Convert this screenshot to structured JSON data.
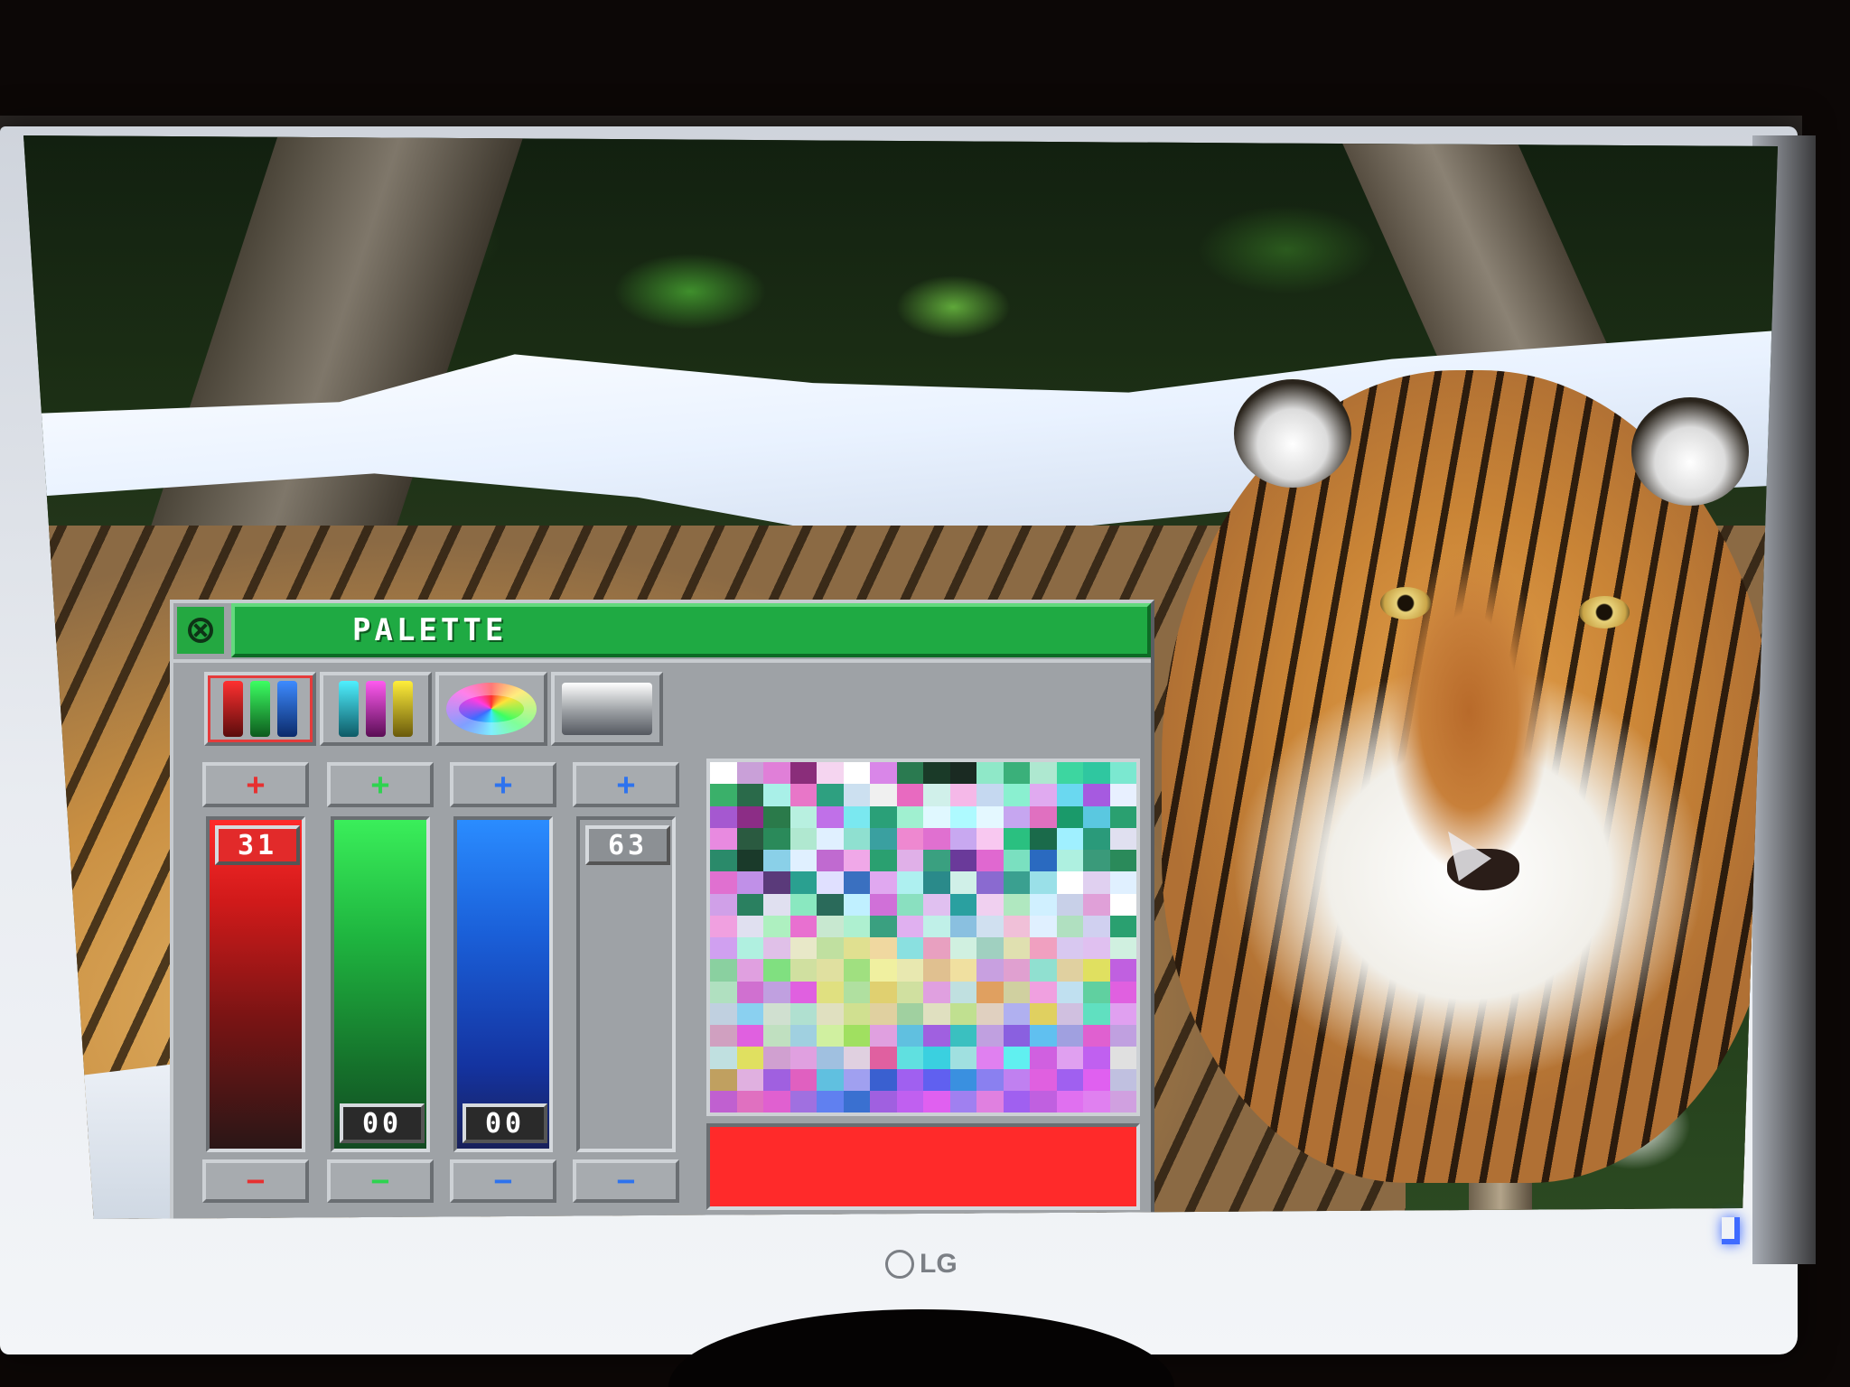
{
  "window": {
    "title": "PALETTE",
    "close_icon": "close-icon"
  },
  "mode_buttons": [
    {
      "name": "rgb-mode-icon",
      "active": true
    },
    {
      "name": "cmy-mode-icon",
      "active": false
    },
    {
      "name": "color-wheel-icon",
      "active": false
    },
    {
      "name": "greyscale-icon",
      "active": false
    }
  ],
  "sliders": {
    "red": {
      "plus": "+",
      "minus": "−",
      "value": "31",
      "color": "#e22a2a"
    },
    "green": {
      "plus": "+",
      "minus": "−",
      "value": "00",
      "color": "#2ed34f"
    },
    "blue": {
      "plus": "+",
      "minus": "−",
      "value": "00",
      "color": "#2e73ee"
    },
    "level": {
      "plus": "+",
      "minus": "−",
      "value": "63",
      "color": "#9ea2a6"
    }
  },
  "current_color": "#ff2a2a",
  "swatch_colors": [
    "#ffffff",
    "#c9a0d8",
    "#e07fd8",
    "#8a2d7a",
    "#f5d5f0",
    "#ffffff",
    "#d986e8",
    "#2a7a50",
    "#1a3a28",
    "#1a2a22",
    "#8fe8c8",
    "#3ab07a",
    "#aee8d0",
    "#3dd6a0",
    "#2fc7a0",
    "#7be8d0",
    "#3ab06a",
    "#2a6a4a",
    "#a9f0e8",
    "#e876c8",
    "#2ea080",
    "#cce0f0",
    "#f0f0f0",
    "#e86ac0",
    "#d0f0ea",
    "#f5b8e8",
    "#c5d8f0",
    "#8af0d0",
    "#e0aaf0",
    "#6ad8f0",
    "#a65ae0",
    "#e8f0ff",
    "#a558d0",
    "#8c2d86",
    "#2a7a4a",
    "#b8f0e0",
    "#c070e8",
    "#7ae8f0",
    "#2aa078",
    "#a0f0d0",
    "#e0f8ff",
    "#aefaff",
    "#e4f8ff",
    "#c6a6f0",
    "#e070c0",
    "#1a9a6a",
    "#5ac8e0",
    "#2aa070",
    "#e88ae0",
    "#2a5a40",
    "#2a8a5a",
    "#b0e8d0",
    "#e0f0ff",
    "#8fe0d0",
    "#3aa0a0",
    "#ee88d0",
    "#e070d0",
    "#c8a8f0",
    "#f8c8f0",
    "#2ac080",
    "#1a6a4a",
    "#a0f0ff",
    "#2a9a7a",
    "#e0e0f0",
    "#2a8a6a",
    "#1a3a2a",
    "#8ad0e8",
    "#e0f0ff",
    "#c06ad0",
    "#f0a8e8",
    "#2aa070",
    "#e0b0e8",
    "#3aa080",
    "#6a3a9a",
    "#e068d0",
    "#7ae0c0",
    "#2a6ac0",
    "#aef0e0",
    "#3a9a7a",
    "#2a8a5a",
    "#e070d0",
    "#c090e8",
    "#5a3a7a",
    "#2aa090",
    "#e0e0ff",
    "#3a70c0",
    "#e0a8f0",
    "#aef0f0",
    "#2a8a8a",
    "#d0f0e8",
    "#8a6ad0",
    "#3aa090",
    "#9ae0e8",
    "#ffffff",
    "#e0d0f0",
    "#e0f0ff",
    "#d0a0e8",
    "#2a8060",
    "#e0e0f0",
    "#8ae8c0",
    "#2a6a5a",
    "#c0f0ff",
    "#d070d8",
    "#8ae0c0",
    "#e0c0f0",
    "#2aa0a0",
    "#f0d0f0",
    "#b0e8c0",
    "#d0f0ff",
    "#c8d0e8",
    "#e0a0d8",
    "#ffffff",
    "#f0a0e0",
    "#e0e0f0",
    "#aef0c0",
    "#e870d0",
    "#c8e8d0",
    "#aef0d0",
    "#3aa080",
    "#e0b0f0",
    "#c0f0e8",
    "#8ac0e0",
    "#d0e0f0",
    "#f0c0d8",
    "#e0f0ff",
    "#b0e0c0",
    "#d0d0f0",
    "#2aa070",
    "#d0a0f0",
    "#b0f0e0",
    "#e0c0e8",
    "#e8e8c8",
    "#c0e0a0",
    "#e0e090",
    "#f0d8a0",
    "#8ae0e0",
    "#e8a0c0",
    "#d0f0e0",
    "#a0d0c0",
    "#e0e0b0",
    "#f0a0c0",
    "#d8c8f0",
    "#e0c0f0",
    "#d0f0e0",
    "#8ad0a0",
    "#e0a0e0",
    "#80e080",
    "#d0e0a0",
    "#e0e0a0",
    "#a0e080",
    "#f0f0a0",
    "#e8e8b0",
    "#e0c090",
    "#f0e0a0",
    "#c8a0e0",
    "#e0a0d0",
    "#90e0d0",
    "#e0d0a0",
    "#e0e060",
    "#c060e0",
    "#b0e0c0",
    "#d070d0",
    "#c0a0e0",
    "#e060e0",
    "#e0e080",
    "#b0e0a0",
    "#e0d070",
    "#d0e0a0",
    "#e0a0e0",
    "#c0e0e0",
    "#e0a060",
    "#d0d0a0",
    "#f0a0e0",
    "#c0e0f0",
    "#60d0a0",
    "#e060e0",
    "#c0d0e0",
    "#8ad0f0",
    "#d0e0d0",
    "#b0e0d0",
    "#e0e0c0",
    "#d0e090",
    "#e0d0a0",
    "#a0d0a0",
    "#e0e0c0",
    "#c0e090",
    "#e0d0c0",
    "#b0b0f0",
    "#e0d060",
    "#d0c0e0",
    "#60e0c0",
    "#e0a0f0",
    "#d0a0c0",
    "#e060e0",
    "#c0e0c0",
    "#a0d0e0",
    "#d0f0a0",
    "#a0e060",
    "#e0a0e0",
    "#60c0e0",
    "#a060e0",
    "#3ac0c0",
    "#c0a0e0",
    "#8a60e0",
    "#60c0f0",
    "#a0a0e0",
    "#e060d0",
    "#c0a0e0",
    "#c0e0e0",
    "#e0e060",
    "#d0a0d0",
    "#e0a0e0",
    "#a0c0e0",
    "#e0d0e0",
    "#e060a0",
    "#60e0e0",
    "#3ad0e0",
    "#a0e0e0",
    "#e080f0",
    "#60f0f0",
    "#d060e0",
    "#e0a0f0",
    "#c060f0",
    "#e0e0e0",
    "#c0a060",
    "#e0b0e0",
    "#a060e0",
    "#e060c0",
    "#60c0e0",
    "#a0a0f0",
    "#3a60d0",
    "#a060f0",
    "#6060f0",
    "#3a90e0",
    "#8a80f0",
    "#c080f0",
    "#e060e0",
    "#a060f0",
    "#e060f0",
    "#c0c0e0",
    "#c060d0",
    "#e070c0",
    "#e060d0",
    "#a070e0",
    "#6080f0",
    "#3a70d0",
    "#a060e0",
    "#c060f0",
    "#e060f0",
    "#a080f0",
    "#e080e0",
    "#a060f0",
    "#c060e0",
    "#e070f0",
    "#e080f0",
    "#d0a0e0"
  ],
  "wallpaper": {
    "description_colors": [
      "#e6a24c",
      "#2f4f22",
      "#ffffff"
    ]
  },
  "monitor": {
    "brand": "LG",
    "led_color": "#3f6bff"
  }
}
